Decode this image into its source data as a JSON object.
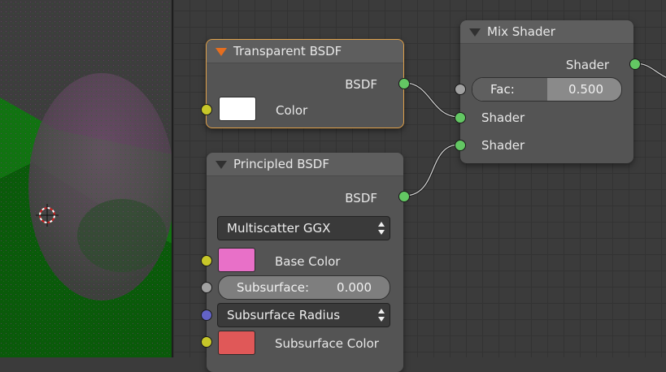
{
  "colors": {
    "socket_shader": "#63c763",
    "socket_color": "#c7c729",
    "socket_float": "#a1a1a1",
    "socket_vector": "#6363c7",
    "active_border": "#e0a14a",
    "transparent_color": "#ffffff",
    "base_color": "#e870c8",
    "subsurface_color": "#e05858"
  },
  "nodes": {
    "transparent": {
      "title": "Transparent BSDF",
      "output": "BSDF",
      "color_label": "Color"
    },
    "mix": {
      "title": "Mix Shader",
      "output": "Shader",
      "fac_label": "Fac:",
      "fac_value": "0.500",
      "fac": 0.5,
      "shader1": "Shader",
      "shader2": "Shader"
    },
    "principled": {
      "title": "Principled BSDF",
      "output": "BSDF",
      "distribution": "Multiscatter GGX",
      "base_color_label": "Base Color",
      "subsurface_label": "Subsurface:",
      "subsurface_value": "0.000",
      "subsurface": 0.0,
      "subsurface_radius": "Subsurface Radius",
      "subsurface_color_label": "Subsurface Color"
    }
  }
}
